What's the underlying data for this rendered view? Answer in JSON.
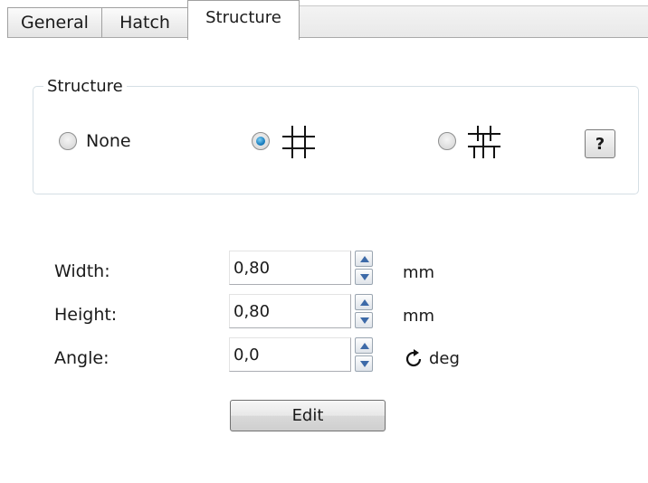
{
  "tabs": [
    {
      "label": "General",
      "active": false
    },
    {
      "label": "Hatch",
      "active": false
    },
    {
      "label": "Structure",
      "active": true
    }
  ],
  "structure_group": {
    "legend": "Structure",
    "options": [
      {
        "label": "None",
        "icon": "none",
        "checked": false
      },
      {
        "label": "",
        "icon": "grid-pattern-icon",
        "checked": true
      },
      {
        "label": "",
        "icon": "grid-offset-pattern-icon",
        "checked": false
      }
    ],
    "help_label": "?"
  },
  "fields": {
    "width": {
      "label": "Width:",
      "value": "0,80",
      "unit": "mm"
    },
    "height": {
      "label": "Height:",
      "value": "0,80",
      "unit": "mm"
    },
    "angle": {
      "label": "Angle:",
      "value": "0,0",
      "unit": "deg",
      "unit_icon": "rotate-clockwise-icon"
    }
  },
  "edit_label": "Edit",
  "colors": {
    "radio_selected": "#1b7fbf",
    "group_border": "#d5dfe5"
  }
}
